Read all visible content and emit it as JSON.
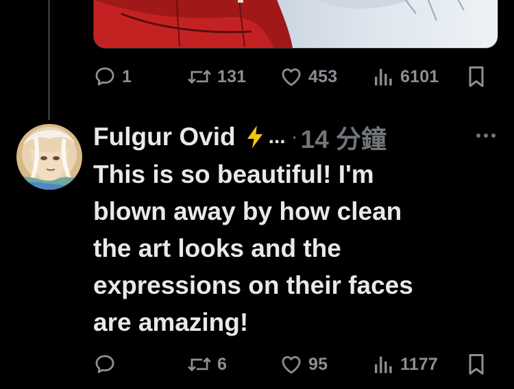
{
  "previous_post": {
    "replies": "1",
    "reposts": "131",
    "likes": "453",
    "views": "6101"
  },
  "reply": {
    "author_name": "Fulgur Ovid",
    "author_emoji": "lightning-bolt",
    "name_truncation": "...",
    "separator": "·",
    "timestamp": "14 分鐘",
    "text_lines": [
      "This is so beautiful! I'm",
      "blown away by how clean",
      "the art looks and the",
      "expressions on their faces",
      "are amazing!"
    ],
    "replies": "",
    "reposts": "6",
    "likes": "95",
    "views": "1177"
  },
  "icons": {
    "reply": "speech-bubble-icon",
    "repost": "repost-arrows-icon",
    "like": "heart-icon",
    "views": "bar-chart-icon",
    "bookmark": "bookmark-icon",
    "more": "more-dots-icon"
  },
  "colors": {
    "background": "#000000",
    "text_primary": "#e7e9ea",
    "text_secondary": "#71767b",
    "bolt": "#f5c518"
  }
}
